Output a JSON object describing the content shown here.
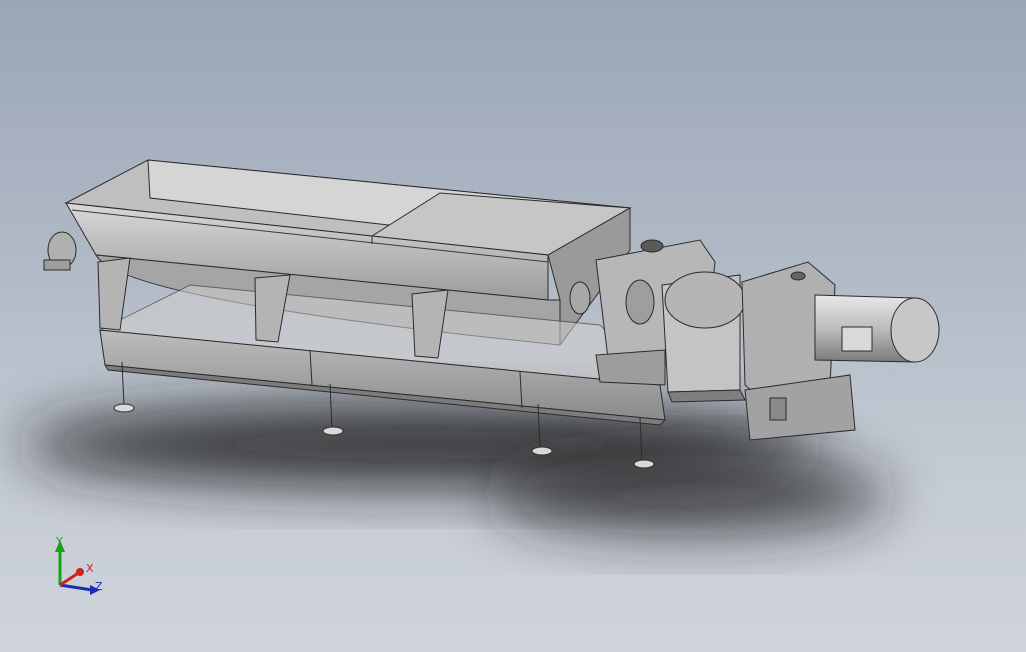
{
  "scene": {
    "model": "screw-conveyor-assembly",
    "view": "isometric",
    "display_style": "shaded-with-edges"
  },
  "triad": {
    "axis_y": "Y",
    "axis_x": "X",
    "axis_z": "Z"
  },
  "colors": {
    "background_top": "#9aa5b6",
    "background_bottom": "#cfd4dc",
    "metal_light": "#c9c9c9",
    "metal_mid": "#a9a9a9",
    "metal_dark": "#6e6e6e",
    "edge": "#2b2b2b",
    "shadow": "#1f1f1f",
    "axis_x": "#d02020",
    "axis_y": "#18a018",
    "axis_z": "#1a2fb0"
  }
}
